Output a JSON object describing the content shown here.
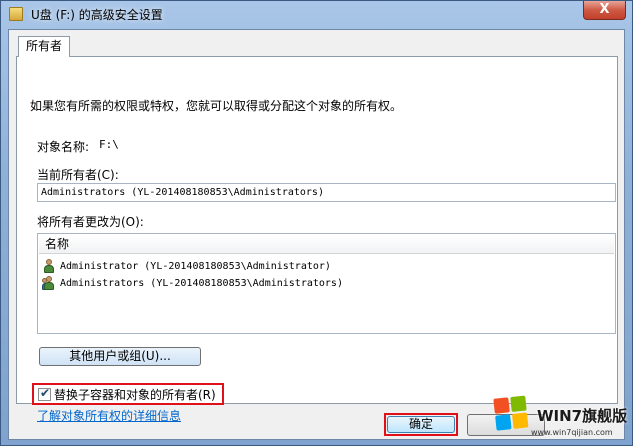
{
  "window": {
    "title": "U盘 (F:) 的高级安全设置",
    "close_label": "X"
  },
  "tabs": [
    {
      "label": "所有者",
      "active": true
    }
  ],
  "owner_tab": {
    "description": "如果您有所需的权限或特权，您就可以取得或分配这个对象的所有权。",
    "object_name_label": "对象名称:",
    "object_name_value": "F:\\",
    "current_owner_label": "当前所有者(C):",
    "current_owner_value": "Administrators (YL-201408180853\\Administrators)",
    "change_owner_label": "将所有者更改为(O):",
    "owner_list": {
      "column_header": "名称",
      "rows": [
        {
          "name": "Administrator (YL-201408180853\\Administrator)",
          "icon": "user-icon"
        },
        {
          "name": "Administrators (YL-201408180853\\Administrators)",
          "icon": "users-group-icon"
        }
      ]
    },
    "other_users_button": "其他用户或组(U)...",
    "replace_owner_checkbox": {
      "label": "替换子容器和对象的所有者(R)",
      "checked": true
    },
    "learn_more_link": "了解对象所有权的详细信息"
  },
  "buttons": {
    "ok": "确定",
    "cancel": ""
  },
  "watermark": {
    "brand": "WIN7旗舰版",
    "url": "www.win7qijian.com"
  },
  "colors": {
    "highlight_box": "#e0101a",
    "link": "#0066cc"
  }
}
